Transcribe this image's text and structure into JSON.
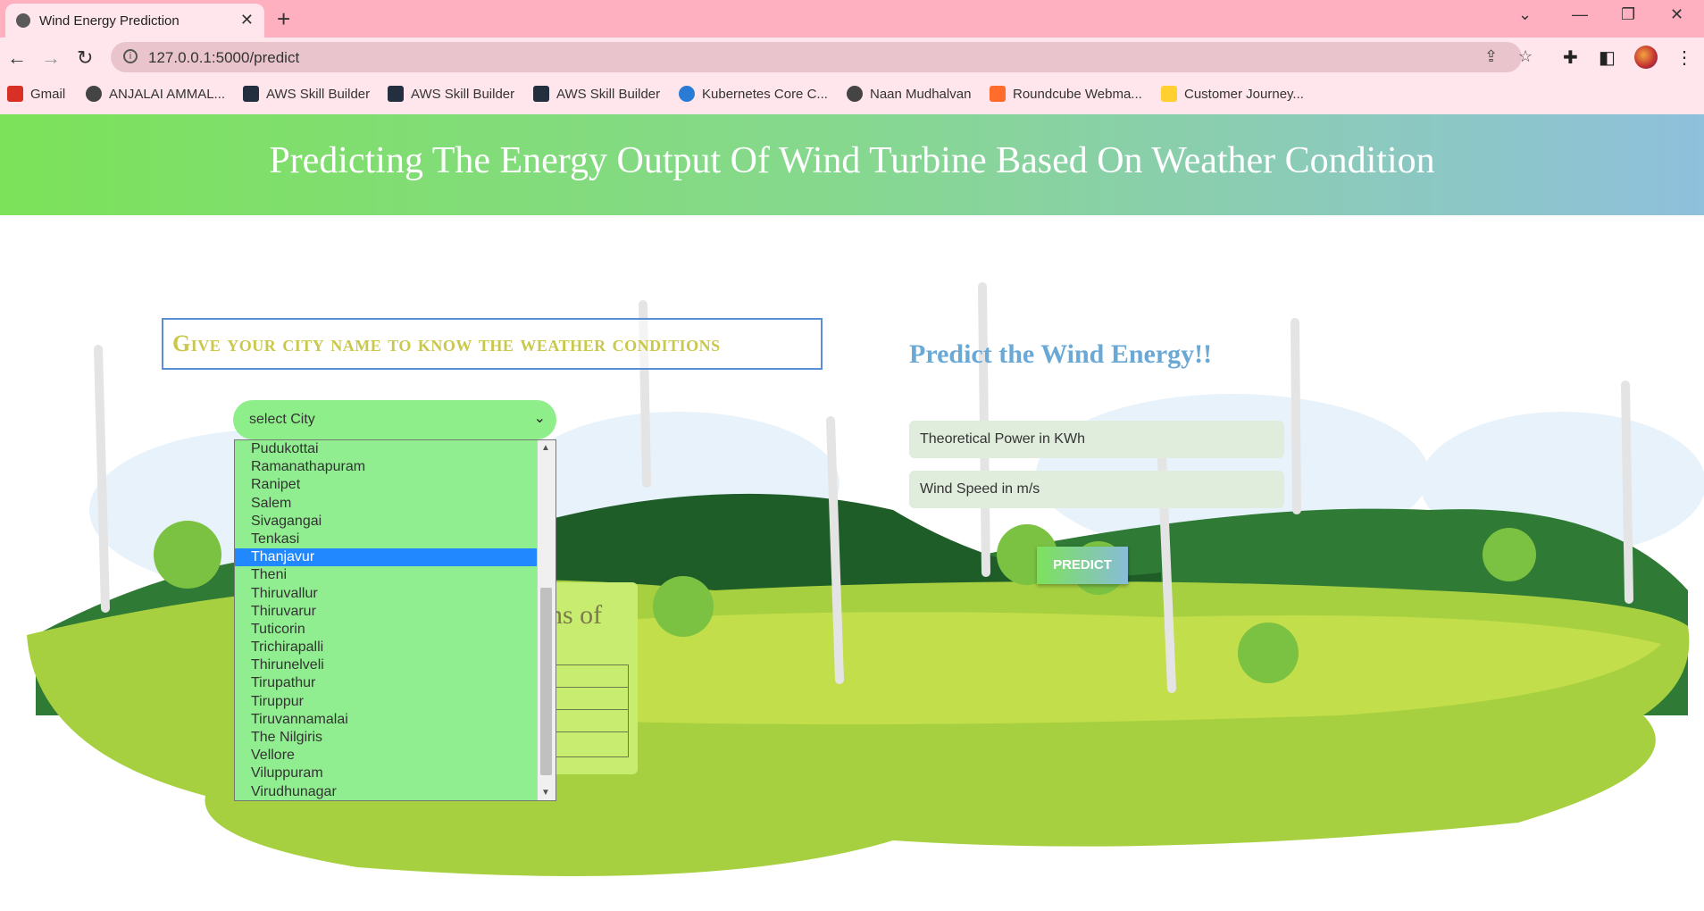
{
  "browser": {
    "tab_title": "Wind Energy Prediction",
    "url": "127.0.0.1:5000/predict",
    "bookmarks": [
      {
        "label": "Gmail",
        "icon": "gmail-icon",
        "color": "#d93025"
      },
      {
        "label": "ANJALAI AMMAL...",
        "icon": "globe-icon",
        "color": "#444444"
      },
      {
        "label": "AWS Skill Builder",
        "icon": "aws-icon",
        "color": "#232f3e"
      },
      {
        "label": "AWS Skill Builder",
        "icon": "aws-icon",
        "color": "#232f3e"
      },
      {
        "label": "AWS Skill Builder",
        "icon": "aws-icon",
        "color": "#232f3e"
      },
      {
        "label": "Kubernetes Core C...",
        "icon": "kubernetes-icon",
        "color": "#2a7bd6"
      },
      {
        "label": "Naan Mudhalvan",
        "icon": "globe-icon",
        "color": "#444444"
      },
      {
        "label": "Roundcube Webma...",
        "icon": "cpanel-icon",
        "color": "#ff6c2c"
      },
      {
        "label": "Customer Journey...",
        "icon": "miro-icon",
        "color": "#ffd02f"
      }
    ]
  },
  "header": {
    "title": "Predicting The Energy Output Of Wind Turbine Based On Weather Condition"
  },
  "city_section": {
    "heading": "Give your city name to know the weather conditions",
    "select_label": "select City",
    "options": [
      "Pudukottai",
      "Ramanathapuram",
      "Ranipet",
      "Salem",
      "Sivagangai",
      "Tenkasi",
      "Thanjavur",
      "Theni",
      "Thiruvallur",
      "Thiruvarur",
      "Tuticorin",
      "Trichirapalli",
      "Thirunelveli",
      "Tirupathur",
      "Tiruppur",
      "Tiruvannamalai",
      "The Nilgiris",
      "Vellore",
      "Viluppuram",
      "Virudhunagar"
    ],
    "selected_option": "Thanjavur",
    "weather_panel_fragment": "ons of"
  },
  "predict_section": {
    "heading": "Predict the Wind Energy!!",
    "power_placeholder": "Theoretical Power in KWh",
    "wind_placeholder": "Wind Speed in m/s",
    "button_label": "PREDICT"
  },
  "colors": {
    "hero_start": "#7ce25a",
    "hero_end": "#8fc0dc",
    "dropdown_bg": "#90ee90",
    "selected_option_bg": "#2188ff",
    "heading_gold": "#c9c84c",
    "heading_blue": "#6aa8d6"
  }
}
